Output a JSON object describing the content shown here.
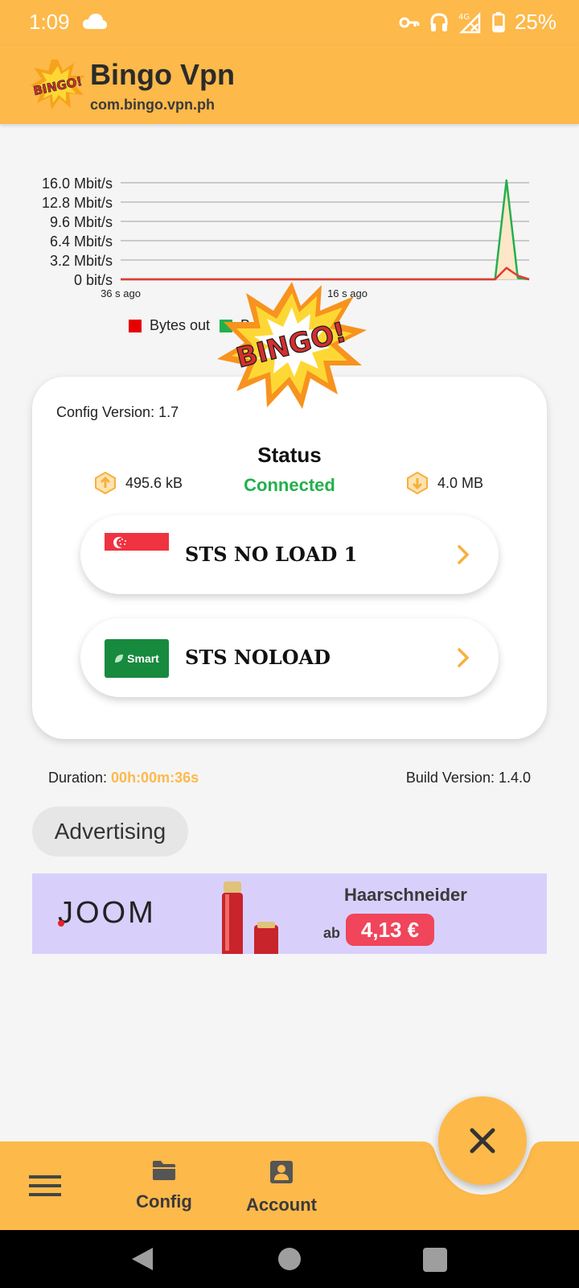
{
  "status_bar": {
    "time": "1:09",
    "battery": "25%",
    "network": "4G",
    "icons": [
      "cloud-icon",
      "key-icon",
      "headset-icon",
      "signal-icon",
      "battery-icon"
    ]
  },
  "app_bar": {
    "title": "Bingo Vpn",
    "subtitle": "com.bingo.vpn.ph",
    "logo_text": "BINGO!"
  },
  "chart_data": {
    "type": "line",
    "y_ticks": [
      "16.0 Mbit/s",
      "12.8 Mbit/s",
      "9.6 Mbit/s",
      "6.4 Mbit/s",
      "3.2 Mbit/s",
      "0 bit/s"
    ],
    "x_ticks": [
      "36 s ago",
      "16 s ago"
    ],
    "ylim": [
      0,
      16.0
    ],
    "x": [
      0,
      1,
      2,
      3,
      4,
      5,
      6,
      7,
      8,
      9,
      10,
      11,
      12,
      13,
      14,
      15,
      16,
      17,
      18,
      19,
      20,
      21,
      22,
      23,
      24,
      25,
      26,
      27,
      28,
      29,
      30,
      31,
      32,
      33,
      34,
      35,
      36
    ],
    "series": [
      {
        "name": "Bytes out",
        "color": "#e53935",
        "values": [
          0,
          0,
          0,
          0,
          0,
          0,
          0,
          0,
          0,
          0,
          0,
          0,
          0,
          0,
          0,
          0,
          0,
          0,
          0,
          0,
          0,
          0,
          0,
          0,
          0,
          0,
          0,
          0,
          0,
          0,
          0,
          0,
          0,
          0,
          1.9,
          0.6,
          0
        ]
      },
      {
        "name": "Bytes in",
        "color": "#22b04b",
        "values": [
          0,
          0,
          0,
          0,
          0,
          0,
          0,
          0,
          0,
          0,
          0,
          0,
          0,
          0,
          0,
          0,
          0,
          0,
          0,
          0,
          0,
          0,
          0,
          0,
          0,
          0,
          0,
          0,
          0,
          0,
          0,
          0,
          0,
          0,
          16.4,
          0.2,
          0
        ]
      }
    ],
    "grid": true,
    "legend": "bottom-left",
    "fill": "#fde7c8"
  },
  "card": {
    "config_version": "Config Version: 1.7",
    "status_title": "Status",
    "status_value": "Connected",
    "upload": "495.6 kB",
    "download": "4.0 MB",
    "servers": [
      {
        "label": "STS NO LOAD 1",
        "flag": "singapore-flag"
      },
      {
        "label": "STS NOLOAD",
        "logo": "Smart"
      }
    ]
  },
  "footer_info": {
    "duration_label": "Duration: ",
    "duration_value": "00h:00m:36s",
    "build_version": "Build Version: 1.4.0"
  },
  "ad": {
    "chip_label": "Advertising",
    "brand": "JOOM",
    "headline": "Haarschneider",
    "prefix": "ab",
    "price": "4,13 €"
  },
  "bottom_nav": {
    "items": [
      {
        "label": "Config",
        "icon": "folder-icon"
      },
      {
        "label": "Account",
        "icon": "account-icon"
      }
    ],
    "menu_icon": "menu-icon",
    "fab_icon": "close-icon"
  },
  "colors": {
    "primary": "#fdb94a",
    "connected": "#22b04b",
    "bytes_out": "#e53935",
    "bytes_in": "#22b04b"
  }
}
